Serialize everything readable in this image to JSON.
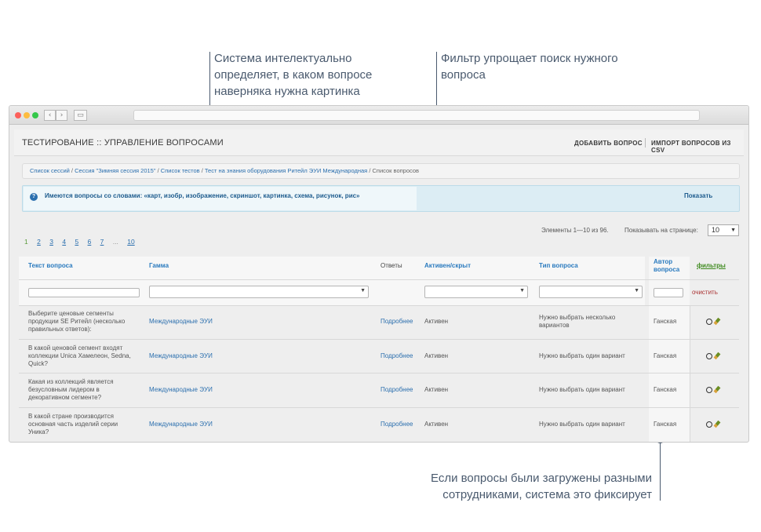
{
  "callouts": {
    "smart": "Система интелектуально определяет, в каком вопросе наверняка нужна картинка",
    "filter": "Фильтр упрощает поиск нужного вопроса",
    "authors": "Если вопросы были загружены разными сотрудниками, система это фиксирует"
  },
  "colors": {
    "accent": "#2b7bbf",
    "callout": "#4a5a6e",
    "alert_bg": "#dcedf4",
    "green": "#3e8a1e"
  },
  "header": {
    "title": "ТЕСТИРОВАНИЕ :: УПРАВЛЕНИЕ ВОПРОСАМИ",
    "add_question": "ДОБАВИТЬ ВОПРОС",
    "import_csv": "ИМПОРТ ВОПРОСОВ ИЗ CSV"
  },
  "breadcrumb": {
    "items": [
      "Список сессий",
      "Сессия \"Зимняя сессия 2015\"",
      "Список тестов",
      "Тест на знания оборудования Ритейл ЭУИ Международная"
    ],
    "current": "Список вопросов",
    "separator": " / "
  },
  "alert": {
    "icon": "info-icon",
    "text": "Имеются вопросы со словами: «карт, изобр, изображение, скриншот, картинка, схема, рисунок, рис»",
    "button": "Показать"
  },
  "pagination": {
    "pages": [
      "1",
      "2",
      "3",
      "4",
      "5",
      "6",
      "7",
      "...",
      "10"
    ],
    "current": "1"
  },
  "elements_info": "Элементы 1—10 из 96.",
  "per_page": {
    "label": "Показывать на странице:",
    "value": "10"
  },
  "table": {
    "columns": {
      "text": "Текст вопроса",
      "gamma": "Гамма",
      "answers": "Ответы",
      "active": "Активен/скрыт",
      "type": "Тип вопроса",
      "author": "Автор вопроса",
      "filters": "фильтры"
    },
    "clear": "очистить",
    "rows": [
      {
        "text": "Выберите ценовые сегменты продукции SE Ритейл (несколько правильных ответов):",
        "gamma": "Международные ЭУИ",
        "answers": "Подробнее",
        "active": "Активен",
        "type": "Нужно выбрать несколько вариантов",
        "author": "Ганская"
      },
      {
        "text": "В какой ценовой сегмент входят коллекции Unica Хамелеон, Sedna, Quick?",
        "gamma": "Международные ЭУИ",
        "answers": "Подробнее",
        "active": "Активен",
        "type": "Нужно выбрать один вариант",
        "author": "Ганская"
      },
      {
        "text": "Какая из коллекций является безусловным лидером в декоративном сегменте?",
        "gamma": "Международные ЭУИ",
        "answers": "Подробнее",
        "active": "Активен",
        "type": "Нужно выбрать один вариант",
        "author": "Ганская"
      },
      {
        "text": "В какой стране производится основная часть изделий серии Уника?",
        "gamma": "Международные ЭУИ",
        "answers": "Подробнее",
        "active": "Активен",
        "type": "Нужно выбрать один вариант",
        "author": "Ганская"
      }
    ]
  }
}
